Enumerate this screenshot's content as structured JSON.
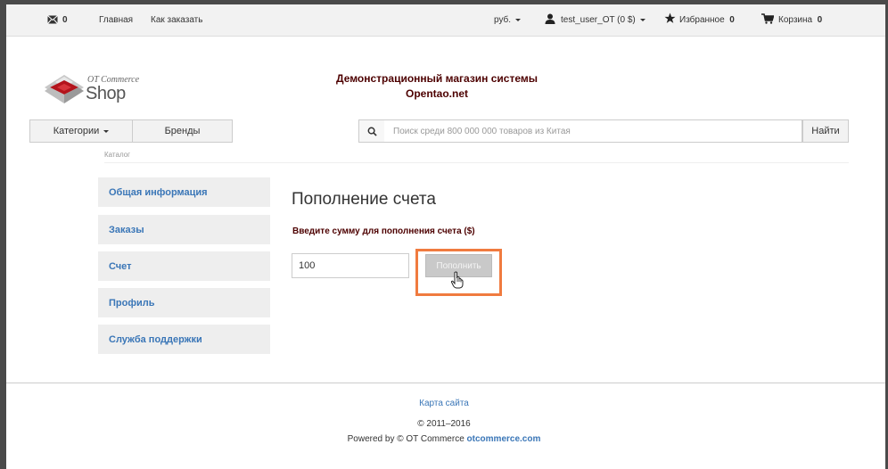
{
  "topbar": {
    "messages_count": "0",
    "home_label": "Главная",
    "how_to_order_label": "Как заказать",
    "currency_label": "руб.",
    "user_label": "test_user_OT (0 $)",
    "favorites_label": "Избранное",
    "favorites_count": "0",
    "cart_label": "Корзина",
    "cart_count": "0"
  },
  "logo": {
    "line1": "OT Commerce",
    "line2": "Shop"
  },
  "header": {
    "line1": "Демонстрационный магазин системы",
    "line2": "Opentao.net"
  },
  "nav": {
    "categories_label": "Категории",
    "brands_label": "Бренды"
  },
  "search": {
    "placeholder": "Поиск среди 800 000 000 товаров из Китая",
    "button_label": "Найти"
  },
  "breadcrumb": {
    "label": "Каталог"
  },
  "sidebar": {
    "items": [
      {
        "label": "Общая информация"
      },
      {
        "label": "Заказы"
      },
      {
        "label": "Счет"
      },
      {
        "label": "Профиль"
      },
      {
        "label": "Служба поддержки"
      }
    ]
  },
  "main": {
    "title": "Пополнение счета",
    "amount_label": "Введите сумму для пополнения счета ($)",
    "amount_value": "100",
    "topup_button": "Пополнить"
  },
  "footer": {
    "sitemap": "Карта сайта",
    "copyright": "© 2011–2016",
    "powered_prefix": "Powered by © OT Commerce ",
    "powered_link": "otcommerce.com"
  },
  "colors": {
    "accent_blue": "#3a76b7",
    "header_maroon": "#4d0000",
    "highlight_orange": "#f07b3f",
    "topbar_bg": "#f2f2f2"
  }
}
